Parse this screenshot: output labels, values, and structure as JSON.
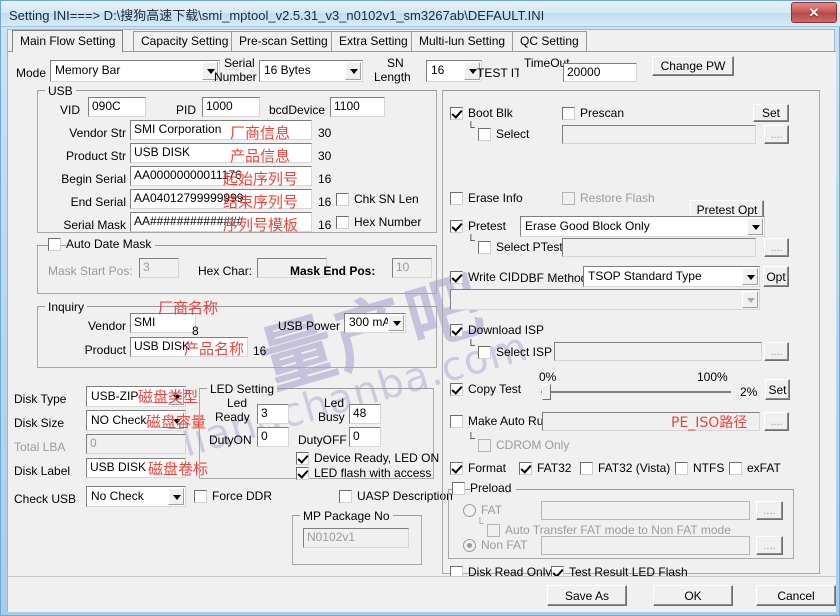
{
  "window": {
    "title": "Setting  INI===> D:\\搜狗高速下载\\smi_mptool_v2.5.31_v3_n0102v1_sm3267ab\\DEFAULT.INI",
    "close_glyph": "✕"
  },
  "watermark": {
    "cn": "量产吧",
    "en": "liangchanba.com"
  },
  "tabs": [
    {
      "label": "Main Flow Setting",
      "active": true
    },
    {
      "label": "Capacity Setting",
      "active": false
    },
    {
      "label": "Pre-scan Setting",
      "active": false
    },
    {
      "label": "Extra Setting",
      "active": false
    },
    {
      "label": "Multi-lun Setting",
      "active": false
    },
    {
      "label": "QC Setting",
      "active": false
    }
  ],
  "top": {
    "mode_label": "Mode",
    "mode_value": "Memory Bar",
    "serial_number_label": "Serial\nNumber",
    "serial_number_label_1": "Serial",
    "serial_number_label_2": "Number",
    "serial_number_value": "16 Bytes",
    "sn_length_label_1": "SN",
    "sn_length_label_2": "Length",
    "sn_length_value": "16",
    "test_item_label": "TEST ITEM",
    "timeout_label": "TimeOut",
    "timeout_value": "20000",
    "change_pw_label": "Change PW"
  },
  "usb": {
    "group_label": "USB",
    "vid_label": "VID",
    "vid_value": "090C",
    "pid_label": "PID",
    "pid_value": "1000",
    "bcd_label": "bcdDevice",
    "bcd_value": "1100",
    "vendor_str_label": "Vendor Str",
    "vendor_str_value": "SMI Corporation",
    "vendor_str_len": "30",
    "vendor_str_anno": "厂商信息",
    "product_str_label": "Product Str",
    "product_str_value": "USB DISK",
    "product_str_len": "30",
    "product_str_anno": "产品信息",
    "begin_serial_label": "Begin Serial",
    "begin_serial_value": "AA00000000011176",
    "begin_serial_len": "16",
    "begin_serial_anno": "起始序列号",
    "end_serial_label": "End Serial",
    "end_serial_value": "AA04012799999999",
    "end_serial_len": "16",
    "end_serial_anno": "结束序列号",
    "chk_sn_len_label": "Chk SN Len",
    "chk_sn_len_checked": false,
    "serial_mask_label": "Serial Mask",
    "serial_mask_value": "AA##############",
    "serial_mask_len": "16",
    "serial_mask_anno": "序列号模板",
    "hex_number_label": "Hex Number",
    "hex_number_checked": false
  },
  "auto_date_mask": {
    "group_label": "Auto Date Mask",
    "checked": false,
    "mask_start_label": "Mask Start Pos:",
    "mask_start_value": "3",
    "hex_char_label": "Hex Char:",
    "hex_char_value": "",
    "mask_end_label": "Mask End Pos:",
    "mask_end_value": "10"
  },
  "inquiry": {
    "group_label": "Inquiry",
    "vendor_label": "Vendor",
    "vendor_value": "SMI",
    "vendor_len": "8",
    "vendor_anno": "厂商名称",
    "product_label": "Product",
    "product_value": "USB DISK",
    "product_len": "16",
    "product_anno": "产品名称",
    "usb_power_label": "USB Power",
    "usb_power_value": "300 mA"
  },
  "disk": {
    "disk_type_label": "Disk Type",
    "disk_type_value": "USB-ZIP",
    "disk_type_anno": "磁盘类型",
    "disk_size_label": "Disk Size",
    "disk_size_value": "NO Check",
    "disk_size_anno": "磁盘容量",
    "total_lba_label": "Total LBA",
    "total_lba_value": "0",
    "disk_label_label": "Disk Label",
    "disk_label_value": "USB DISK",
    "disk_label_anno": "磁盘卷标",
    "check_usb_label": "Check USB",
    "check_usb_value": "No Check",
    "force_ddr_label": "Force DDR",
    "force_ddr_checked": false
  },
  "led": {
    "group_label": "LED Setting",
    "led_ready_label_1": "Led",
    "led_ready_label_2": "Ready",
    "led_ready_value": "3",
    "led_busy_label_1": "Led",
    "led_busy_label_2": "Busy",
    "led_busy_value": "48",
    "duty_on_label": "DutyON",
    "duty_on_value": "0",
    "duty_off_label": "DutyOFF",
    "duty_off_value": "0",
    "device_ready_label": "Device Ready, LED ON",
    "device_ready_checked": true,
    "flash_access_label": "LED flash with access",
    "flash_access_checked": true
  },
  "uasp": {
    "label": "UASP Description",
    "checked": false
  },
  "mp_package": {
    "group_label": "MP Package No",
    "value": "N0102v1"
  },
  "right": {
    "boot_blk_label": "Boot Blk",
    "boot_blk_checked": true,
    "prescan_label": "Prescan",
    "prescan_checked": false,
    "set_button": "Set",
    "select_label": "Select",
    "select_checked": false,
    "select_value": "",
    "browse_label": "....",
    "erase_info_label": "Erase Info",
    "erase_info_checked": false,
    "restore_flash_label": "Restore Flash",
    "restore_flash_checked": false,
    "pretest_opt_button": "Pretest Opt",
    "pretest_label": "Pretest",
    "pretest_checked": true,
    "pretest_value": "Erase Good Block Only",
    "select_ptest_label": "Select PTest",
    "select_ptest_checked": false,
    "select_ptest_value": "",
    "write_cid_label": "Write CID",
    "write_cid_checked": true,
    "dbf_method_label": "DBF Method",
    "dbf_method_value": "TSOP Standard Type",
    "opt_button": "Opt",
    "cid_extra_value": "",
    "download_isp_label": "Download ISP",
    "download_isp_checked": true,
    "select_isp_label": "Select ISP",
    "select_isp_checked": false,
    "select_isp_value": "",
    "copy_test_label": "Copy Test",
    "copy_test_checked": true,
    "copy_min_label": "0%",
    "copy_max_label": "100%",
    "copy_value_label": "2%",
    "copy_set_button": "Set",
    "make_auto_run_label": "Make Auto Run",
    "make_auto_run_checked": false,
    "make_auto_run_value": "",
    "make_auto_run_anno": "PE_ISO路径",
    "cdrom_only_label": "CDROM Only",
    "cdrom_only_checked": false,
    "format_label": "Format",
    "format_checked": true,
    "fat32_label": "FAT32",
    "fat32_checked": true,
    "fat32_vista_label": "FAT32 (Vista)",
    "fat32_vista_checked": false,
    "ntfs_label": "NTFS",
    "ntfs_checked": false,
    "exfat_label": "exFAT",
    "exfat_checked": false,
    "preload_label": "Preload",
    "preload_checked": false,
    "fat_label": "FAT",
    "fat_selected": false,
    "fat_path": "",
    "auto_transfer_label": "Auto Transfer FAT mode to Non FAT mode",
    "auto_transfer_checked": false,
    "non_fat_label": "Non FAT",
    "non_fat_selected": true,
    "non_fat_path": "",
    "disk_read_only_label": "Disk Read Only",
    "disk_read_only_checked": false,
    "test_result_led_label": "Test Result LED Flash",
    "test_result_led_checked": true
  },
  "footer": {
    "save_as": "Save  As",
    "ok": "OK",
    "cancel": "Cancel"
  },
  "colors": {
    "annotation_red": "#e8463c",
    "watermark_purple": "#6858b0",
    "title_blue": "#c3dcf0",
    "close_red": "#c85a5a"
  }
}
